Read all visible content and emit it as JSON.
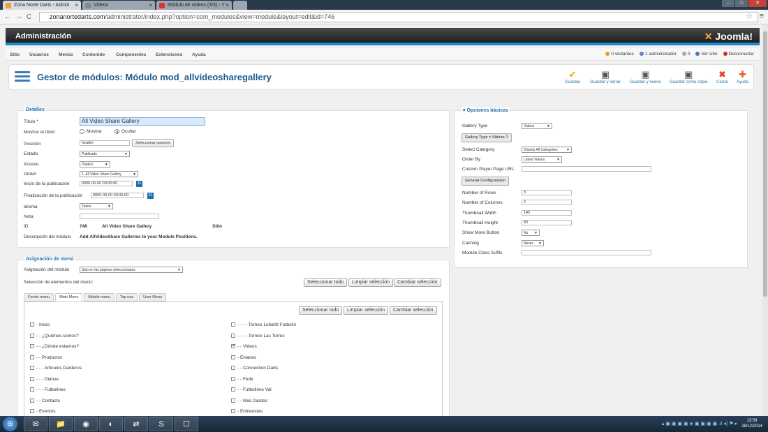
{
  "browser": {
    "tabs": [
      {
        "label": "Zona Norte Darts - Admin",
        "color": "#f0a030"
      },
      {
        "label": "Videos",
        "color": "#888888"
      },
      {
        "label": "Módulo de videos (3/3) - Y",
        "color": "#e03030"
      }
    ],
    "window_buttons": [
      "–",
      "□",
      "✕"
    ],
    "back": "←",
    "forward": "→",
    "reload": "C",
    "url_host": "zonanortedarts.com",
    "url_path": "/administrator/index.php?option=com_modules&view=module&layout=edit&id=746"
  },
  "header": {
    "title": "Administración",
    "logo": "Joomla!",
    "logo_mark": "✕"
  },
  "mainnav": {
    "items": [
      "Sitio",
      "Usuarios",
      "Menús",
      "Contenido",
      "Componentes",
      "Extensiones",
      "Ayuda"
    ],
    "status": {
      "visitors": "0 visitantes",
      "admins": "1 administrador",
      "messages": "0",
      "view_site": "Ver sitio",
      "logout": "Desconectar"
    }
  },
  "toolbar": {
    "page_title": "Gestor de módulos: Módulo mod_allvideosharegallery",
    "buttons": [
      {
        "label": "Guardar",
        "icon": "check-icon",
        "glyph": "✔",
        "color": "#f0a000"
      },
      {
        "label": "Guardar y cerrar",
        "icon": "save-close-icon",
        "glyph": "▣",
        "color": "#555555"
      },
      {
        "label": "Guardar y nuevo",
        "icon": "save-new-icon",
        "glyph": "▣",
        "color": "#555555"
      },
      {
        "label": "Guardar como copia",
        "icon": "save-copy-icon",
        "glyph": "▣",
        "color": "#555555"
      },
      {
        "label": "Cerrar",
        "icon": "close-icon",
        "glyph": "✖",
        "color": "#e03a20"
      },
      {
        "label": "Ayuda",
        "icon": "help-icon",
        "glyph": "✚",
        "color": "#e06020"
      }
    ]
  },
  "details": {
    "legend": "Detalles",
    "title_label": "Título",
    "required_mark": "*",
    "title_value": "All Video Share Gallery",
    "show_title_label": "Mostrar el título",
    "show_option": "Mostrar",
    "hide_option": "Ocultar",
    "position_label": "Posición",
    "position_value": "header",
    "select_position": "Seleccionar posición",
    "state_label": "Estado",
    "state_value": "Publicado",
    "access_label": "Acceso",
    "access_value": "Público",
    "order_label": "Orden",
    "order_value": "1. All Video Share Gallery",
    "publish_up_label": "Inicio de la publicación",
    "publish_up_value": "0000-00-00 00:00:00",
    "publish_down_label": "Finalización de la publicación",
    "publish_down_value": "0000-00-00 00:00:00",
    "calendar_glyph": "31",
    "language_label": "Idioma",
    "language_value": "Todos",
    "note_label": "Nota",
    "id_label": "ID",
    "id_value": "746",
    "id_name": "All Video Share Gallery",
    "id_site": "Sitio",
    "desc_label": "Descripción del módulo",
    "desc_value": "Add AllVideoShare Galleries to your Module Positions."
  },
  "menu_assignment": {
    "legend": "Asignación de menú",
    "assign_label": "Asignación del módulo",
    "assign_value": "Solo en las páginas seleccionadas",
    "select_items_label": "Selección de elementos del menú:",
    "select_all": "Seleccionar todo",
    "clear_selection": "Limpiar selección",
    "toggle_selection": "Cambiar selección",
    "tabs": [
      "Footer menu",
      "Main Menu",
      "Mobile menu",
      "Top nav",
      "User Menu"
    ],
    "left_items": [
      {
        "label": "- Inicio",
        "checked": false
      },
      {
        "label": "- - ¿Quiénes somos?",
        "checked": false
      },
      {
        "label": "- - ¿Dónde estamos?",
        "checked": false
      },
      {
        "label": "- - Productos",
        "checked": false
      },
      {
        "label": "- - - Articulos Darderos",
        "checked": false
      },
      {
        "label": "- - - Dianas",
        "checked": false
      },
      {
        "label": "- - - Futbolines",
        "checked": false
      },
      {
        "label": "- - Contacto",
        "checked": false
      },
      {
        "label": "- Eventos",
        "checked": false
      }
    ],
    "right_items": [
      {
        "label": "- - - - Torneo Luhartz Futbolin",
        "checked": false
      },
      {
        "label": "- - - - Torneo Las Torres",
        "checked": false
      },
      {
        "label": "- - Videos",
        "checked": true
      },
      {
        "label": "- Enlaces",
        "checked": false
      },
      {
        "label": "- - Connection Darts",
        "checked": false
      },
      {
        "label": "- - Fede",
        "checked": false
      },
      {
        "label": "- - Futbolines Val",
        "checked": false
      },
      {
        "label": "- - Mas Dardos",
        "checked": false
      },
      {
        "label": "- Entrevistas",
        "checked": false
      }
    ]
  },
  "basic_options": {
    "legend": "Opciones básicas",
    "toggle_glyph": "▾",
    "gallery_type_label": "Gallery Type",
    "gallery_type_value": "Videos",
    "gallery_type_header": "Gallery Type = Videos ?",
    "select_category_label": "Select Category",
    "select_category_value": "Display All Categories",
    "order_by_label": "Order By",
    "order_by_value": "Latest Videos",
    "player_page_label": "Custom Player Page URL",
    "general_header": "General Configuration",
    "rows_label": "Number of Rows",
    "rows_value": "3",
    "columns_label": "Number of Columns",
    "columns_value": "2",
    "thumb_width_label": "Thumbnail Width",
    "thumb_width_value": "145",
    "thumb_height_label": "Thumbnail Height",
    "thumb_height_value": "80",
    "show_more_label": "Show More Button",
    "show_more_value": "No",
    "caching_label": "Caching",
    "caching_value": "Never",
    "class_suffix_label": "Module Class Suffix"
  },
  "taskbar": {
    "start": "⊞",
    "apps": [
      "✉",
      "📁",
      "◉",
      "◐",
      "⇄",
      "S",
      "☐"
    ],
    "tray": "▴ ▣ ▣ ▣ ▣ ◈ ▣ ▣ ▣ ▣ .ıl ◂) ⚑ ▸",
    "time": "13:59",
    "date": "26/12/2014"
  }
}
